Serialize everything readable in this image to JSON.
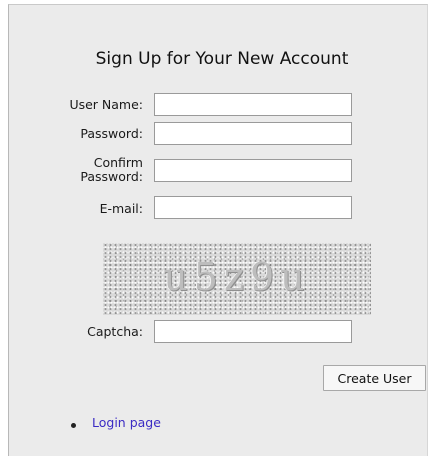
{
  "form": {
    "title": "Sign Up for Your New Account",
    "fields": {
      "username_label": "User Name:",
      "password_label": "Password:",
      "confirm_label_line1": "Confirm",
      "confirm_label_line2": "Password:",
      "email_label": "E-mail:",
      "captcha_label": "Captcha:"
    },
    "captcha_text": "u5z9u",
    "submit_label": "Create User"
  },
  "links": {
    "login_label": "Login page"
  }
}
